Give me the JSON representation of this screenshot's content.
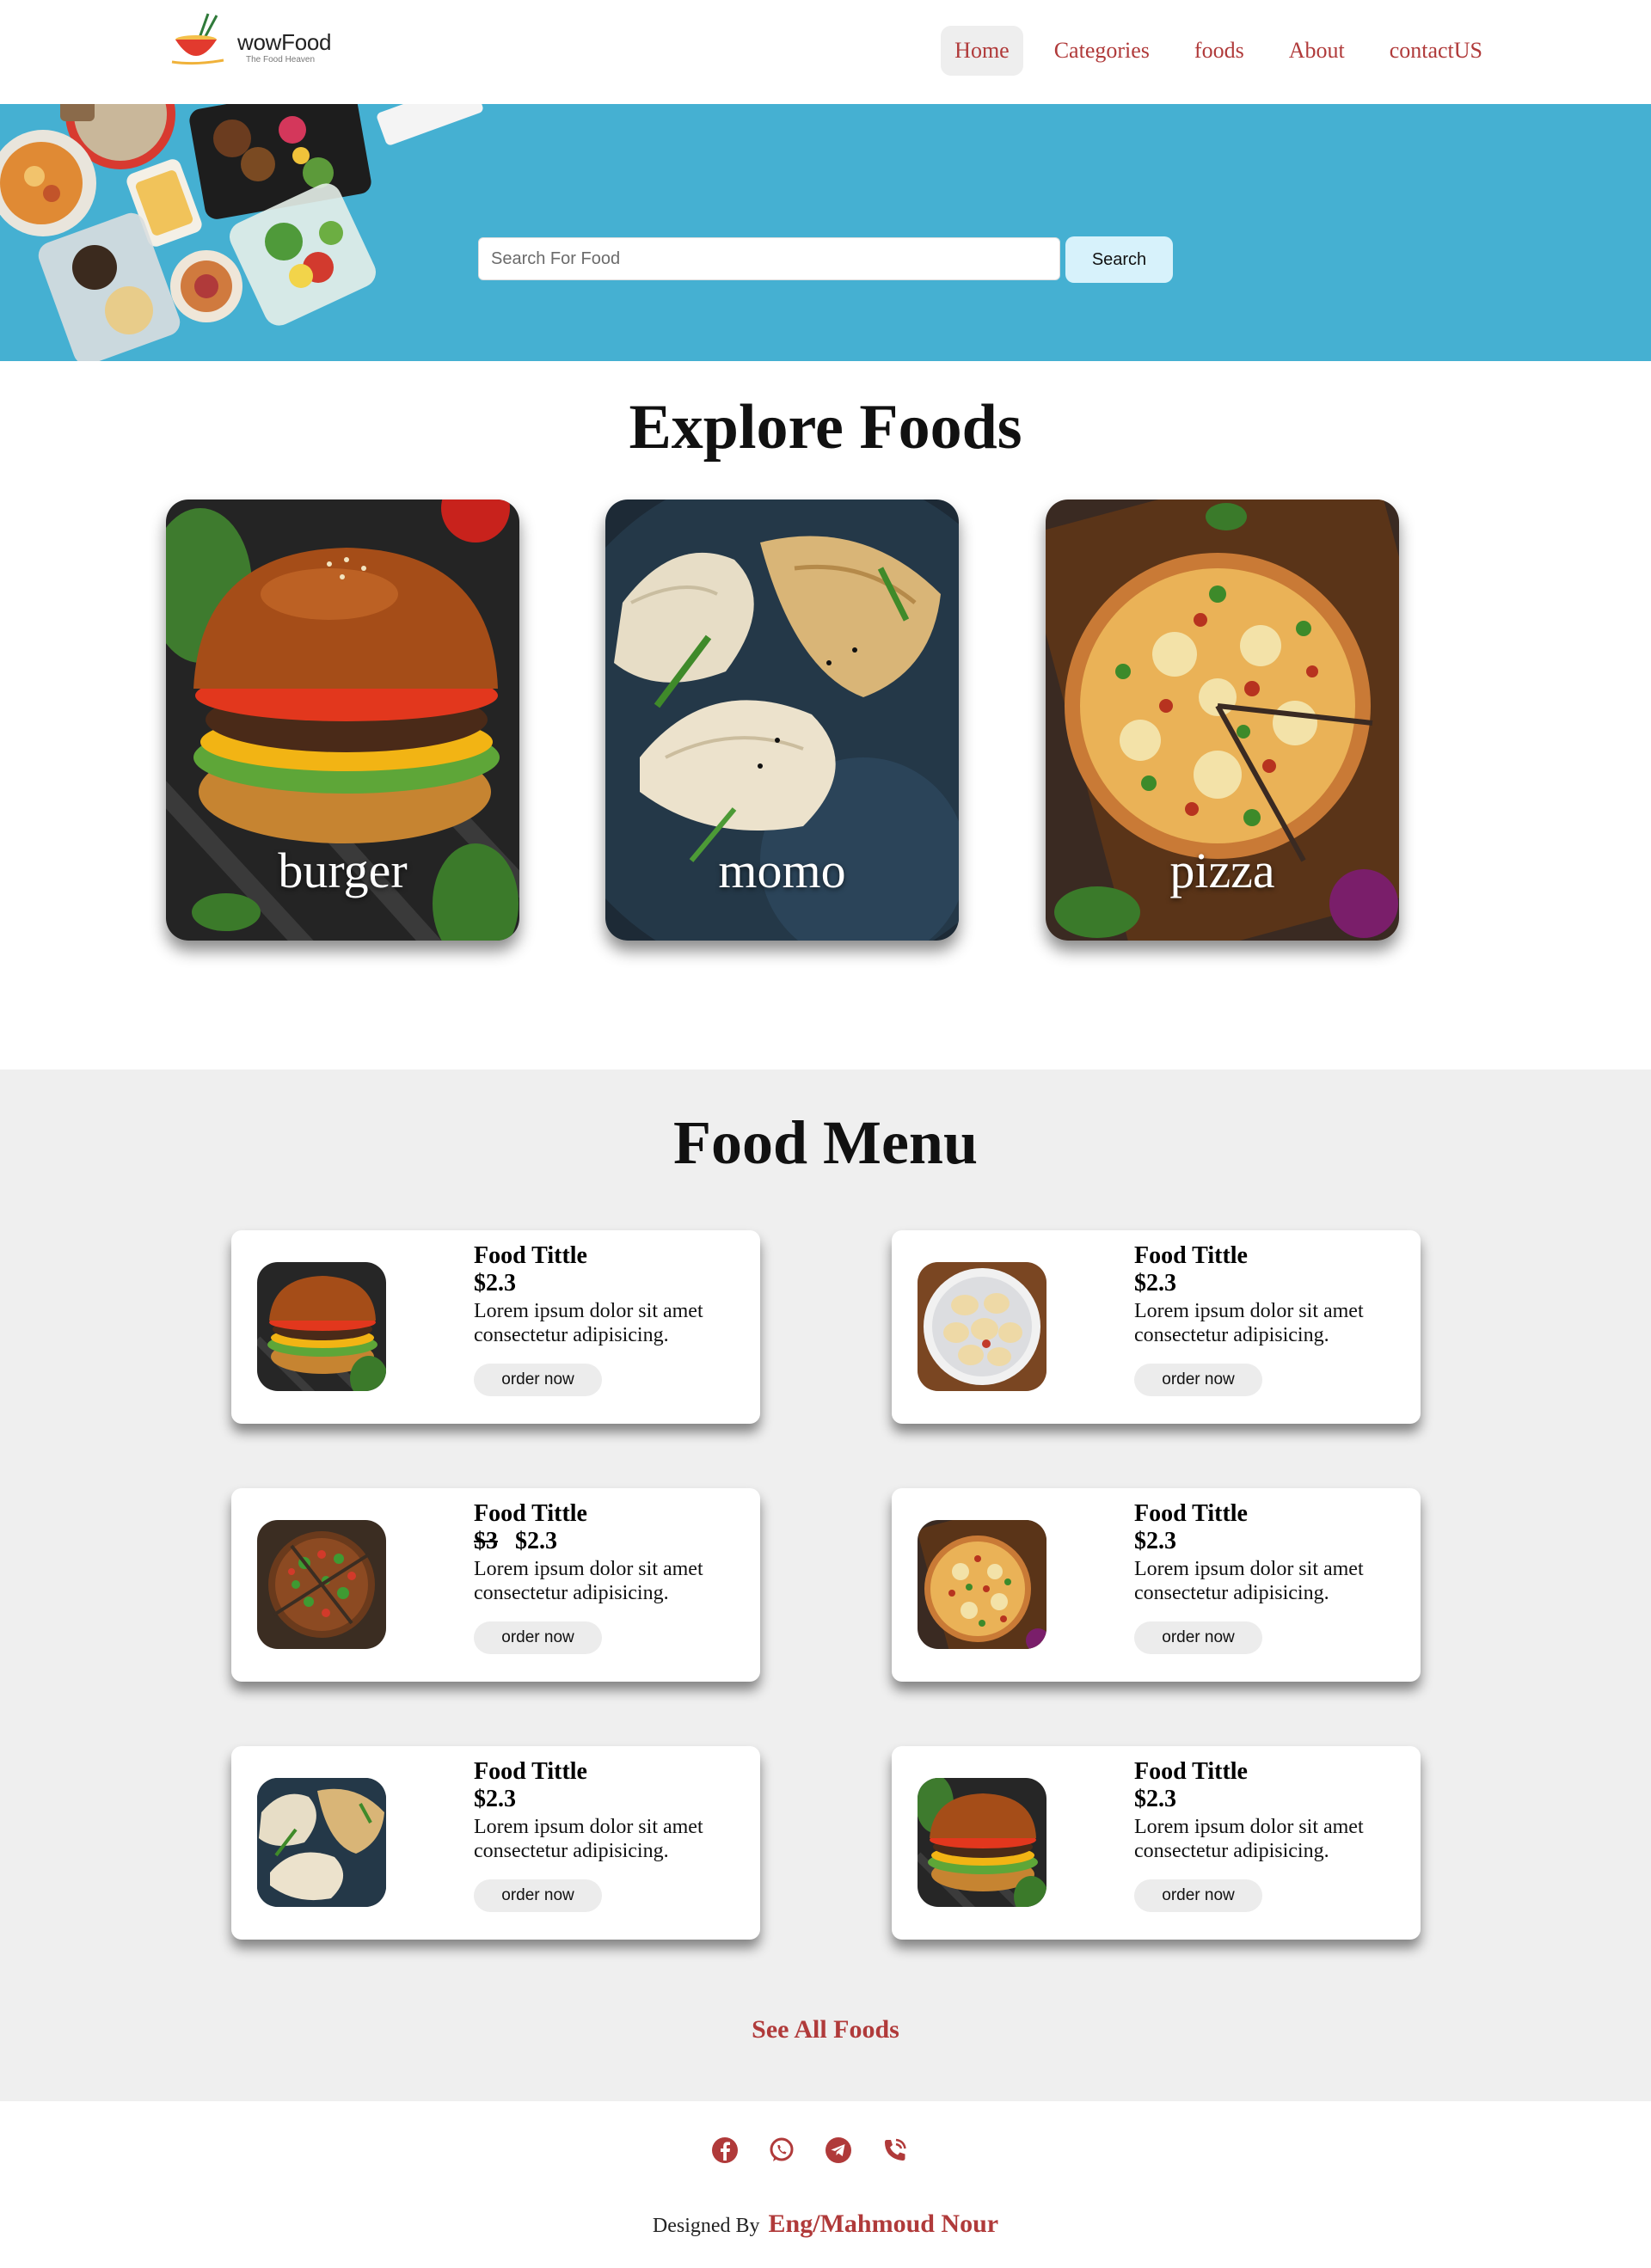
{
  "brand": {
    "name": "wowFood",
    "tagline": "The Food Heaven"
  },
  "nav": {
    "items": [
      "Home",
      "Categories",
      "foods",
      "About",
      "contactUS"
    ],
    "active": "Home"
  },
  "hero": {
    "search_placeholder": "Search For Food",
    "search_button": "Search"
  },
  "explore": {
    "title": "Explore Foods",
    "categories": [
      {
        "label": "burger",
        "image": "burger-photo"
      },
      {
        "label": "momo",
        "image": "momo-photo"
      },
      {
        "label": "pizza",
        "image": "pizza-photo"
      }
    ]
  },
  "menu": {
    "title": "Food Menu",
    "items": [
      {
        "name": "Food Tittle",
        "old_price": "",
        "price": "$2.3",
        "description": "Lorem ipsum dolor sit amet consectetur adipisicing.",
        "button": "order now",
        "image": "burger-photo"
      },
      {
        "name": "Food Tittle",
        "old_price": "",
        "price": "$2.3",
        "description": "Lorem ipsum dolor sit amet consectetur adipisicing.",
        "button": "order now",
        "image": "momo-plate-photo"
      },
      {
        "name": "Food Tittle",
        "old_price": "$3",
        "price": "$2.3",
        "description": "Lorem ipsum dolor sit amet consectetur adipisicing.",
        "button": "order now",
        "image": "veggie-pizza-photo"
      },
      {
        "name": "Food Tittle",
        "old_price": "",
        "price": "$2.3",
        "description": "Lorem ipsum dolor sit amet consectetur adipisicing.",
        "button": "order now",
        "image": "pizza-photo"
      },
      {
        "name": "Food Tittle",
        "old_price": "",
        "price": "$2.3",
        "description": "Lorem ipsum dolor sit amet consectetur adipisicing.",
        "button": "order now",
        "image": "momo-photo"
      },
      {
        "name": "Food Tittle",
        "old_price": "",
        "price": "$2.3",
        "description": "Lorem ipsum dolor sit amet consectetur adipisicing.",
        "button": "order now",
        "image": "burger-photo"
      }
    ],
    "see_all": "See All Foods"
  },
  "footer": {
    "social": [
      "facebook-icon",
      "whatsapp-icon",
      "telegram-icon",
      "phone-icon"
    ],
    "designed_by": "Designed By",
    "author": "Eng/Mahmoud Nour"
  },
  "colors": {
    "accent": "#b03a3a",
    "hero_bg": "#45b0d2",
    "menu_bg": "#efefef",
    "search_btn": "#d7f2fb"
  }
}
